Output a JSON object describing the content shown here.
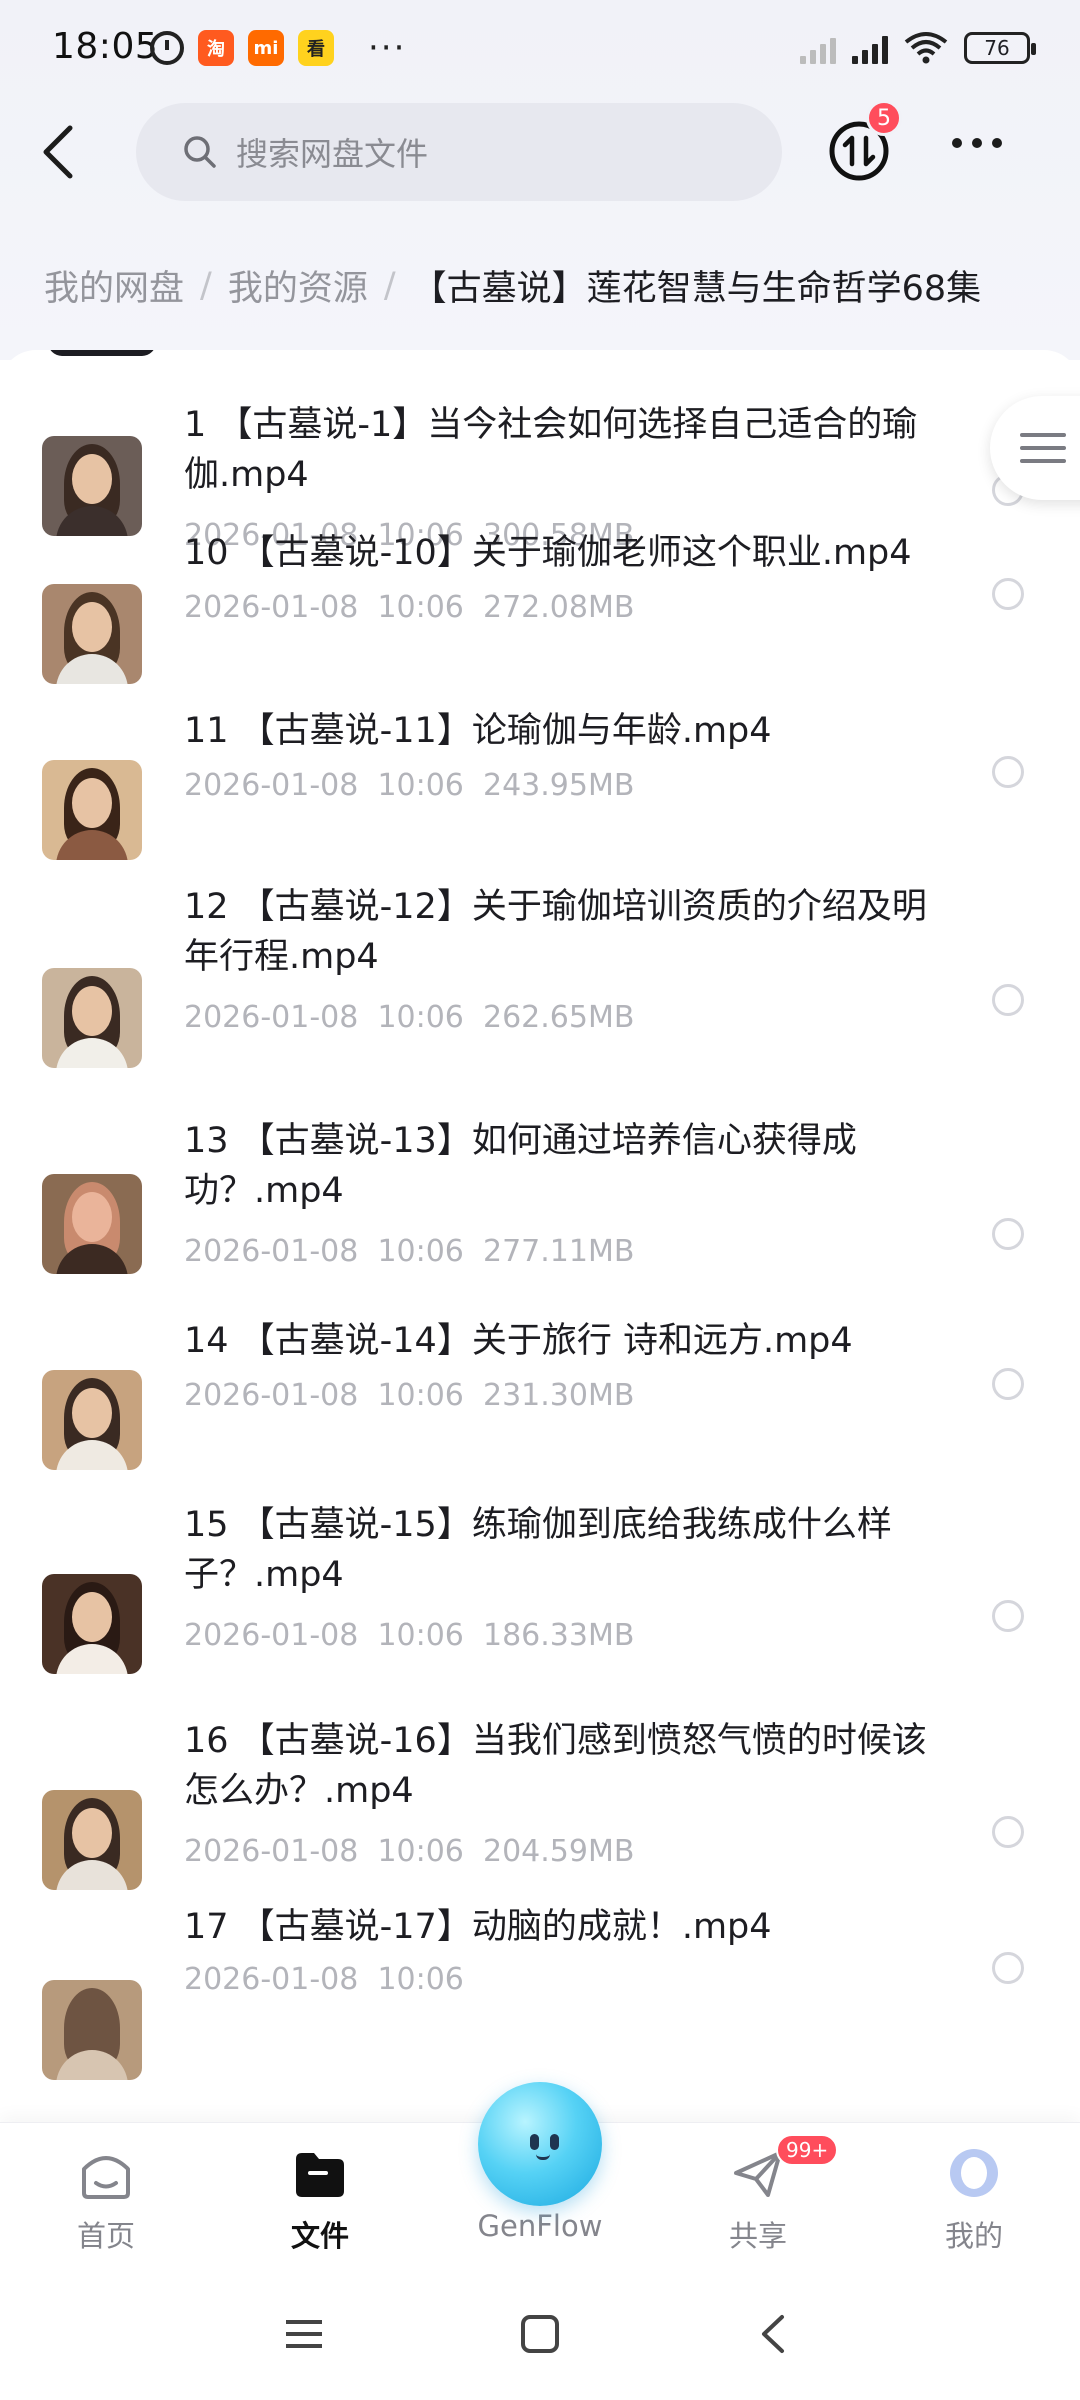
{
  "status_bar": {
    "time": "18:05",
    "battery": "76",
    "more": "···"
  },
  "header": {
    "search_placeholder": "搜索网盘文件",
    "sort_badge": "5"
  },
  "breadcrumb": {
    "items": [
      "我的网盘",
      "我的资源"
    ],
    "current": "【古墓说】莲花智慧与生命哲学68集",
    "separator": "/"
  },
  "files": [
    {
      "name": "1 【古墓说-1】当今社会如何选择自己适合的瑜伽.mp4",
      "date": "2026-01-08",
      "time": "10:06",
      "size": "300.58MB"
    },
    {
      "name": "10 【古墓说-10】关于瑜伽老师这个职业.mp4",
      "date": "2026-01-08",
      "time": "10:06",
      "size": "272.08MB"
    },
    {
      "name": "11 【古墓说-11】论瑜伽与年龄.mp4",
      "date": "2026-01-08",
      "time": "10:06",
      "size": "243.95MB"
    },
    {
      "name": "12 【古墓说-12】关于瑜伽培训资质的介绍及明年行程.mp4",
      "date": "2026-01-08",
      "time": "10:06",
      "size": "262.65MB"
    },
    {
      "name": "13 【古墓说-13】如何通过培养信心获得成功？.mp4",
      "date": "2026-01-08",
      "time": "10:06",
      "size": "277.11MB"
    },
    {
      "name": "14 【古墓说-14】关于旅行 诗和远方.mp4",
      "date": "2026-01-08",
      "time": "10:06",
      "size": "231.30MB"
    },
    {
      "name": "15 【古墓说-15】练瑜伽到底给我练成什么样子？.mp4",
      "date": "2026-01-08",
      "time": "10:06",
      "size": "186.33MB"
    },
    {
      "name": "16 【古墓说-16】当我们感到愤怒气愤的时候该怎么办？.mp4",
      "date": "2026-01-08",
      "time": "10:06",
      "size": "204.59MB"
    },
    {
      "name": "17 【古墓说-17】动脑的成就！.mp4",
      "date": "2026-01-08",
      "time": "10:06",
      "size": ""
    }
  ],
  "bottom_nav": {
    "home": "首页",
    "files": "文件",
    "genflow": "GenFlow",
    "share": "共享",
    "share_badge": "99+",
    "me": "我的"
  },
  "colors": {
    "accent_badge": "#ff4d5c",
    "page_bg_top": "#f1f2f8",
    "search_bg": "#e7e8ef",
    "meta_text": "#b3b4ba"
  }
}
